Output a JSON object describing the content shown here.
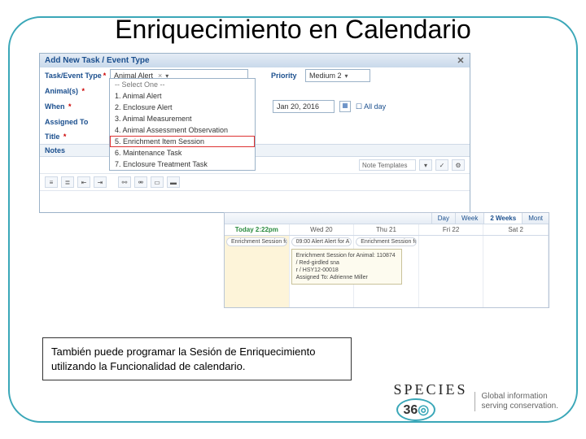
{
  "slide": {
    "title": "Enriquecimiento en Calendario"
  },
  "dialog": {
    "header": "Add New Task / Event Type",
    "labels": {
      "type": "Task/Event Type",
      "animals": "Animal(s)",
      "when": "When",
      "assigned": "Assigned To",
      "title": "Title",
      "notes": "Notes"
    },
    "type_value": "Animal Alert",
    "priority_label": "Priority",
    "priority_value": "Medium  2",
    "date_value": "Jan 20, 2016",
    "allday_label": "All day",
    "note_templates": "Note Templates"
  },
  "dropdown": {
    "placeholder": "-- Select One --",
    "items": [
      "1. Animal Alert",
      "2. Enclosure Alert",
      "3. Animal Measurement",
      "4. Animal Assessment Observation",
      "5. Enrichment Item Session",
      "6. Maintenance Task",
      "7. Enclosure Treatment Task"
    ],
    "highlight_index": 4
  },
  "calendar": {
    "tabs": [
      "Day",
      "Week",
      "2 Weeks",
      "Mont"
    ],
    "active_tab": 2,
    "today_label": "Today 2:22pm",
    "days": [
      "Wed 20",
      "Thu 21",
      "Fri 22",
      "Sat 2"
    ],
    "events": {
      "today_event": "Enrichment Session fo",
      "wed_event": "09:00 Alert Alert for A",
      "thu_event": "Enrichment Session for"
    },
    "tooltip": {
      "line1": "Enrichment Session for Animal: 110874 / Red-girdled sna",
      "line2": "r / HSY12-00018",
      "line3": "Assigned To: Adrienne Miller"
    }
  },
  "caption": {
    "line1": "También  puede programar la Sesión de Enriquecimiento",
    "line2": "utilizando la Funcionalidad de calendario."
  },
  "logo": {
    "brand": "SPECIES",
    "num": "36",
    "tag1": "Global information",
    "tag2": "serving conservation."
  }
}
